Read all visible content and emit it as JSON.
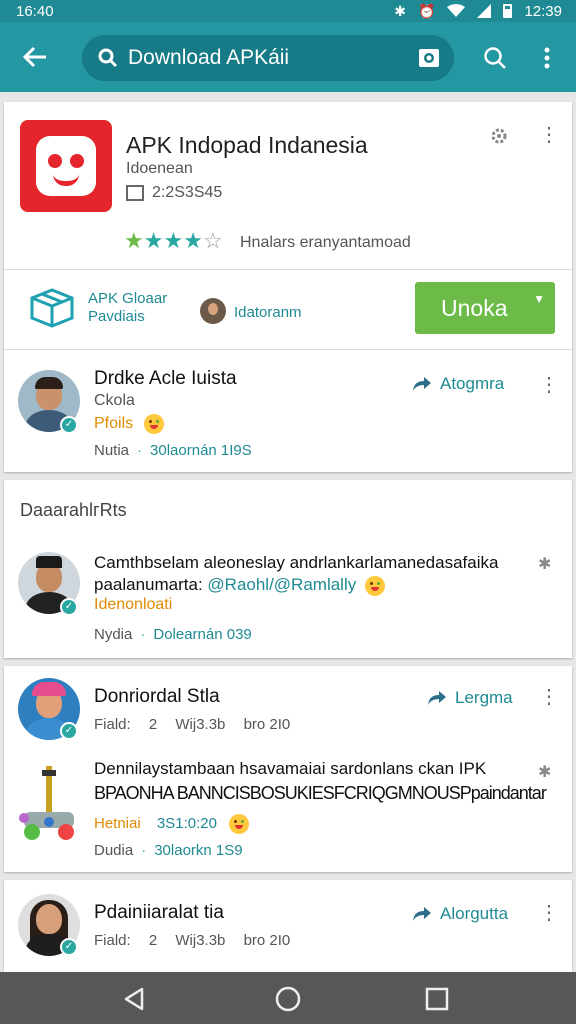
{
  "status_bar": {
    "time": "16:40",
    "clock_right": "12:39"
  },
  "toolbar": {
    "search_value": "Download APKáii"
  },
  "app": {
    "title": "APK Indopad Indanesia",
    "developer": "Idoenean",
    "size": "2:2S3S45",
    "rating": 4,
    "rating_max": 5,
    "rating_text": "Hnalars eranyantamoad",
    "feature1_line1": "APK Gloaar",
    "feature1_line2": "Pavdiais",
    "feature2": "Idatoranm",
    "install_label": "Unoka"
  },
  "post1": {
    "name": "Drdke Acle Iuista",
    "line2": "Ckola",
    "line3": "Pfoils",
    "meta_left": "Nutia",
    "meta_right": "30laornán 1I9S",
    "action": "Atogmra"
  },
  "section": {
    "header": "DaaarahlгRts"
  },
  "post2": {
    "line1": "Camthbselam aleoneslay andrlankarlamanedasafaika",
    "line2_prefix": "paalanumarta: ",
    "line2_link": "@Raohl/@Ramlally",
    "line3": "Idenonloati",
    "meta_left": "Nydia",
    "meta_right": "Dolearnán 039"
  },
  "post3": {
    "name": "Donriordal Stla",
    "sub_left": "Fiald:",
    "sub_num": "2",
    "sub_mid": "Wĳ3.3b",
    "sub_right": "bro 2I0",
    "action": "Lergma",
    "body1": "Dennilaystambaan hsavamaiai sardonlans ckan IPK",
    "body2": "BPAONHA BANNCISBOSUKIESFCRIQGMNOUSPpaindantar",
    "tag_left": "Hetniai",
    "tag_right": "3S1:0:20",
    "meta_left": "Dudia",
    "meta_right": "30laorkn 1S9"
  },
  "post4": {
    "name": "Pdainiiaralat tia",
    "sub_left": "Fiald:",
    "sub_num": "2",
    "sub_mid": "Wĳ3.3b",
    "sub_right": "bro 2I0",
    "action": "Alorgutta"
  },
  "colors": {
    "teal": "#2397a2",
    "install_green": "#6cbb48",
    "app_red": "#e4252b"
  }
}
